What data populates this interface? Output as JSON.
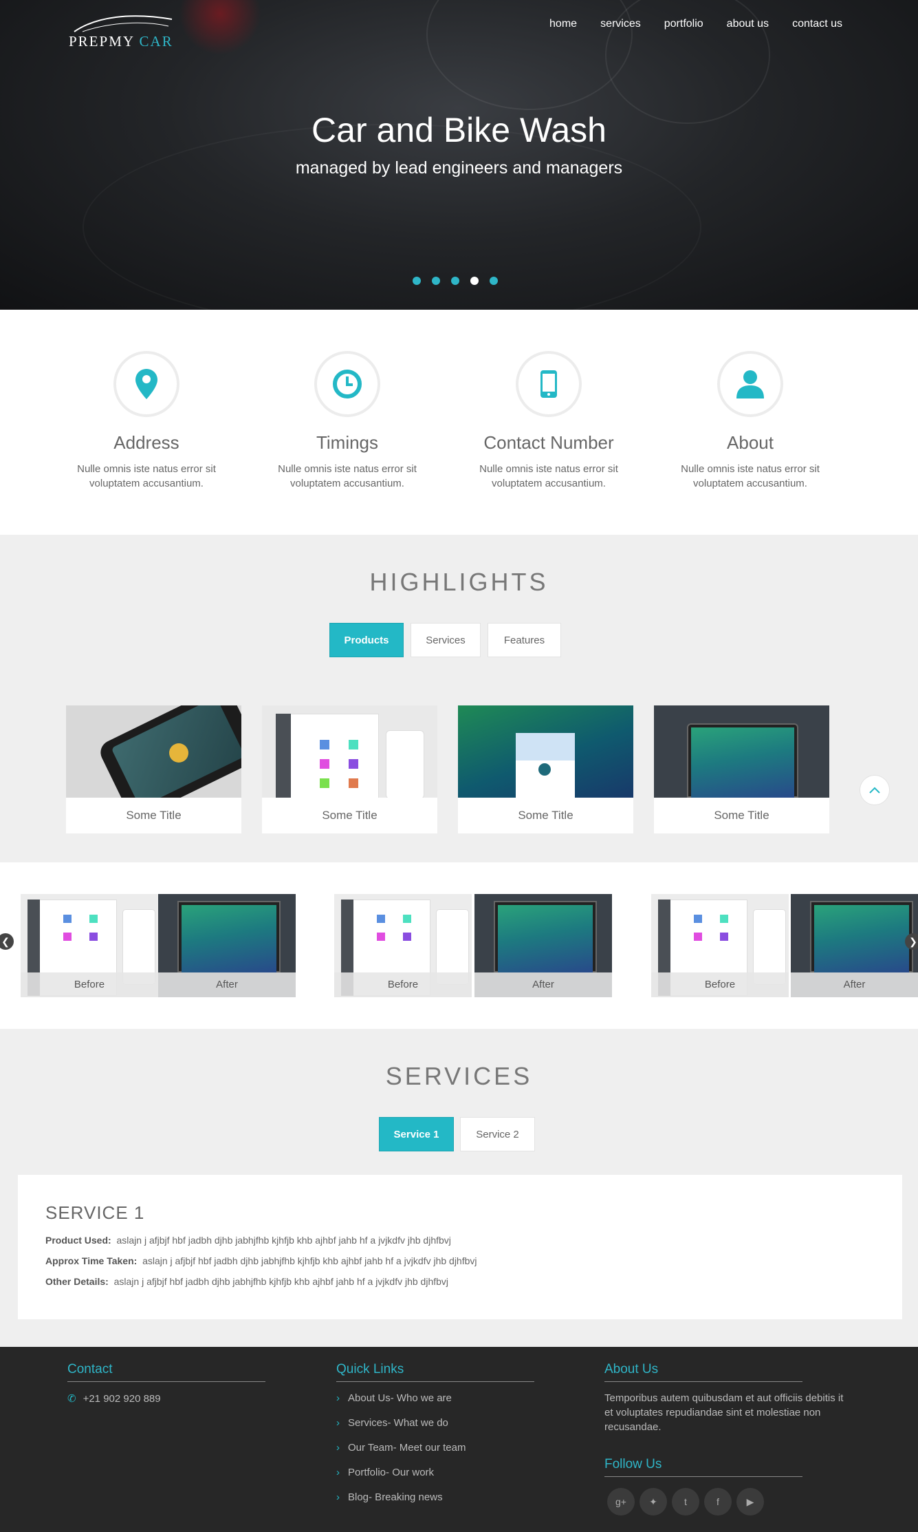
{
  "brand": {
    "logo_text_1": "PREPMY",
    "logo_text_2": "CAR"
  },
  "nav": [
    "home",
    "services",
    "portfolio",
    "about us",
    "contact us"
  ],
  "hero": {
    "title": "Car and Bike Wash",
    "subtitle": "managed by lead engineers and managers",
    "slide_count": 5,
    "active_slide": 4
  },
  "features": [
    {
      "icon": "map-pin-icon",
      "title": "Address",
      "text": "Nulle omnis iste natus error sit voluptatem accusantium."
    },
    {
      "icon": "clock-icon",
      "title": "Timings",
      "text": "Nulle omnis iste natus error sit voluptatem accusantium."
    },
    {
      "icon": "phone-icon",
      "title": "Contact Number",
      "text": "Nulle omnis iste natus error sit voluptatem accusantium."
    },
    {
      "icon": "user-icon",
      "title": "About",
      "text": "Nulle omnis iste natus error sit voluptatem accusantium."
    }
  ],
  "highlights": {
    "title": "HIGHLIGHTS",
    "tabs": [
      "Products",
      "Services",
      "Features"
    ],
    "active_tab": "Products",
    "cards": [
      "Some Title",
      "Some Title",
      "Some Title",
      "Some Title"
    ]
  },
  "before_after": {
    "pairs": [
      {
        "before": "Before",
        "after": "After"
      },
      {
        "before": "Before",
        "after": "After"
      },
      {
        "before": "Before",
        "after": "After"
      }
    ]
  },
  "services": {
    "title": "SERVICES",
    "tabs": [
      "Service 1",
      "Service 2"
    ],
    "active_tab": "Service 1",
    "panel": {
      "heading": "SERVICE 1",
      "rows": [
        {
          "label": "Product Used:",
          "value": "aslajn j afjbjf hbf jadbh djhb jabhjfhb kjhfjb khb ajhbf jahb hf a jvjkdfv jhb djhfbvj"
        },
        {
          "label": "Approx Time Taken:",
          "value": "aslajn j afjbjf hbf jadbh djhb jabhjfhb kjhfjb khb ajhbf jahb hf a jvjkdfv jhb djhfbvj"
        },
        {
          "label": "Other Details:",
          "value": "aslajn j afjbjf hbf jadbh djhb jabhjfhb kjhfjb khb ajhbf jahb hf a jvjkdfv jhb djhfbvj"
        }
      ]
    }
  },
  "footer": {
    "contact": {
      "heading": "Contact",
      "phone": "+21 902 920 889"
    },
    "quick_links": {
      "heading": "Quick Links",
      "items": [
        "About Us- Who we are",
        "Services- What we do",
        "Our Team- Meet our team",
        "Portfolio- Our work",
        "Blog- Breaking news"
      ]
    },
    "about": {
      "heading": "About Us",
      "text": "Temporibus autem quibusdam et aut officiis debitis it et voluptates repudiandae sint et molestiae non recusandae."
    },
    "follow": {
      "heading": "Follow Us",
      "icons": [
        "google-plus-icon",
        "twitter-icon",
        "tumblr-icon",
        "facebook-icon",
        "youtube-icon"
      ]
    }
  },
  "colors": {
    "accent": "#23b8c6",
    "footer_bg": "#272727",
    "section_bg": "#efefef"
  }
}
